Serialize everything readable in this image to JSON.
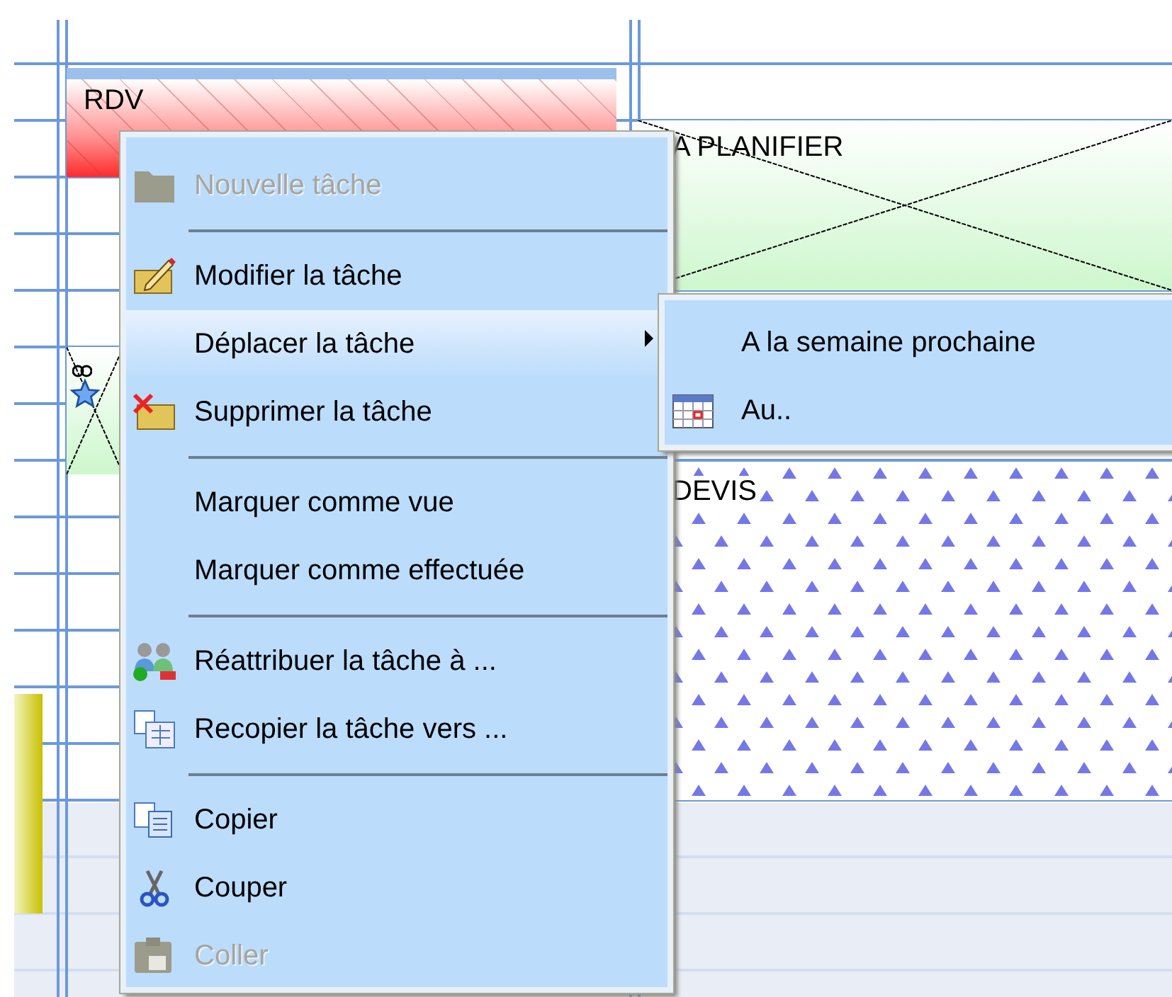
{
  "calendar": {
    "tasks": [
      {
        "kind": "appointment",
        "title": "RDV"
      },
      {
        "kind": "to_plan",
        "title": "A PLANIFIER"
      },
      {
        "kind": "to_plan"
      },
      {
        "kind": "quote",
        "title": "DEVIS"
      },
      {
        "kind": "bar"
      }
    ]
  },
  "context_menu": {
    "items": [
      {
        "kind": "item",
        "label": "Nouvelle tâche",
        "disabled": true,
        "selected": false
      },
      {
        "kind": "separator"
      },
      {
        "kind": "item",
        "label": "Modifier la tâche",
        "disabled": false,
        "selected": false
      },
      {
        "kind": "item",
        "label": "Déplacer la tâche",
        "disabled": false,
        "selected": true,
        "submenu": true
      },
      {
        "kind": "item",
        "label": "Supprimer la tâche",
        "disabled": false,
        "selected": false
      },
      {
        "kind": "separator"
      },
      {
        "kind": "item",
        "label": "Marquer comme vue",
        "disabled": false,
        "selected": false
      },
      {
        "kind": "item",
        "label": "Marquer comme effectuée",
        "disabled": false,
        "selected": false
      },
      {
        "kind": "separator"
      },
      {
        "kind": "item",
        "label": "Réattribuer la tâche à ...",
        "disabled": false,
        "selected": false
      },
      {
        "kind": "item",
        "label": "Recopier la tâche vers ...",
        "disabled": false,
        "selected": false
      },
      {
        "kind": "separator"
      },
      {
        "kind": "item",
        "label": "Copier",
        "disabled": false,
        "selected": false
      },
      {
        "kind": "item",
        "label": "Couper",
        "disabled": false,
        "selected": false
      },
      {
        "kind": "item",
        "label": "Coller",
        "disabled": true,
        "selected": false
      }
    ]
  },
  "submenu": {
    "items": [
      {
        "label": "A la semaine prochaine"
      },
      {
        "label": "Au.."
      }
    ]
  }
}
